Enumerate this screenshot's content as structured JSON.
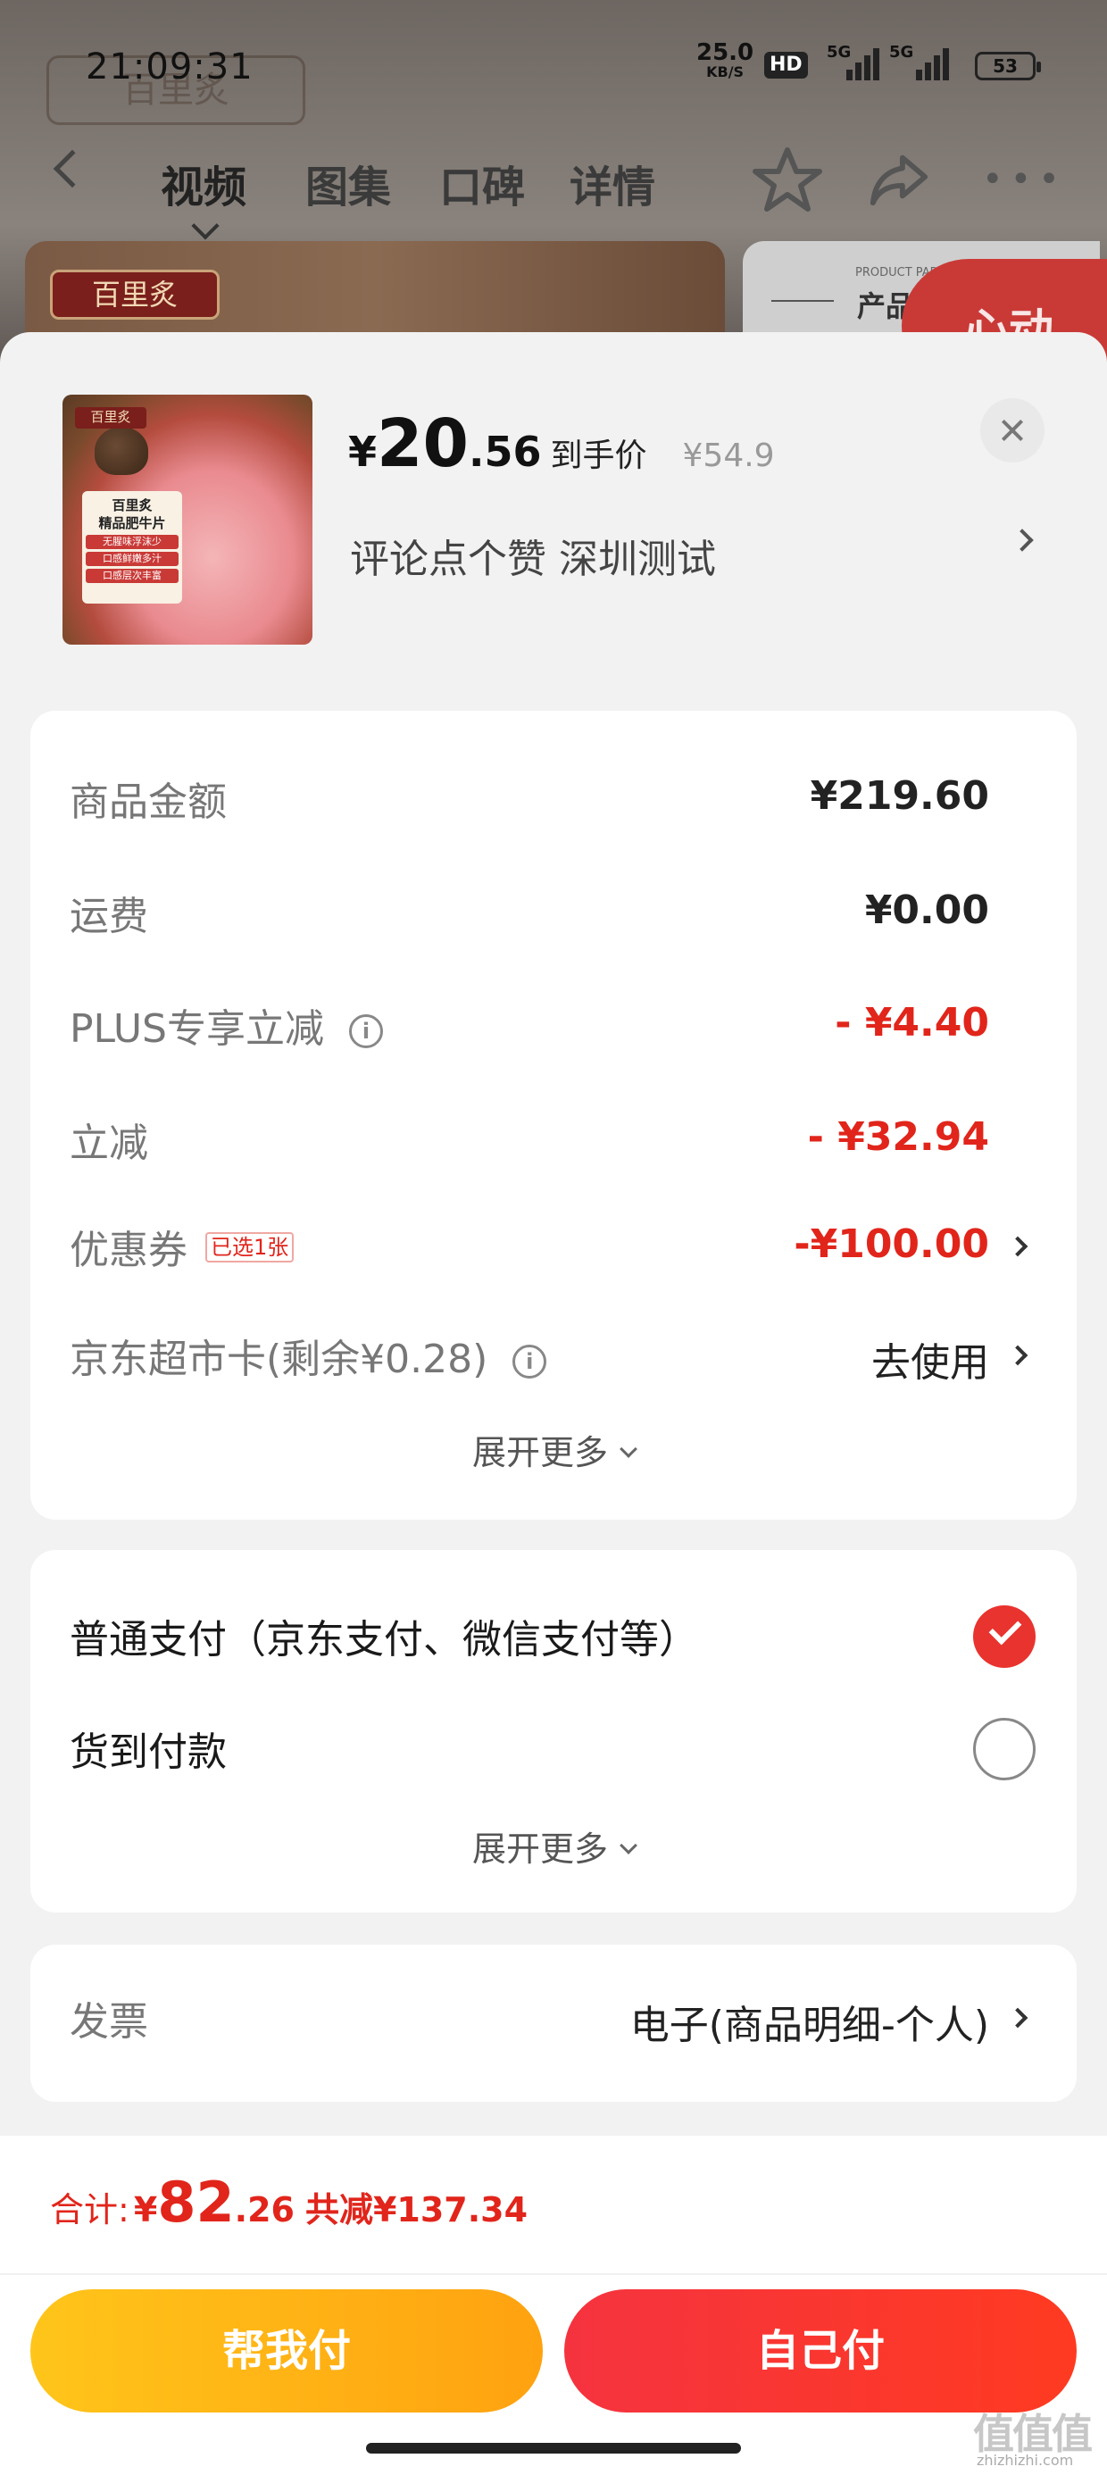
{
  "status_bar": {
    "time": "21:09:31",
    "net_speed_value": "25.0",
    "net_speed_unit": "KB/S",
    "hd": "HD",
    "signal_1": "5G",
    "signal_2": "5G",
    "battery": "53"
  },
  "background": {
    "brand_ghost": "百里炙",
    "brand_logo": "百里炙",
    "tabs": [
      "视频",
      "图集",
      "口碑",
      "详情"
    ],
    "param_small": "PRODUCT PARAMET",
    "param_title": "产品",
    "badge": "心动"
  },
  "product": {
    "image_logo": "百里炙",
    "image_pack_title": "百里炙",
    "image_pack_name": "精品肥牛片",
    "image_pack_tags": [
      "无腥味浮沫少",
      "口感鲜嫩多汁",
      "口感层次丰富"
    ],
    "price_currency": "¥",
    "price_integer": "20",
    "price_decimal": ".56",
    "price_label": "到手价",
    "original_price": "¥54.9",
    "subtitle": "评论点个赞  深圳测试"
  },
  "summary": {
    "rows": [
      {
        "label": "商品金额",
        "value": "¥219.60"
      },
      {
        "label": "运费",
        "value": "¥0.00"
      },
      {
        "label": "PLUS专享立减",
        "value": "- ¥4.40"
      },
      {
        "label": "立减",
        "value": "- ¥32.94"
      },
      {
        "label": "优惠券",
        "tag": "已选1张",
        "value": "-¥100.00"
      },
      {
        "label": "京东超市卡(剩余¥0.28)",
        "value": "去使用"
      }
    ],
    "expand_label": "展开更多"
  },
  "payment": {
    "options": [
      {
        "label": "普通支付（京东支付、微信支付等）",
        "selected": true
      },
      {
        "label": "货到付款",
        "selected": false
      }
    ],
    "expand_label": "展开更多"
  },
  "invoice": {
    "label": "发票",
    "value": "电子(商品明细-个人)"
  },
  "footer": {
    "total_label": "合计:",
    "total_currency": "¥",
    "total_integer": "82",
    "total_decimal": ".26",
    "discount_text": "共减¥137.34",
    "btn_friend": "帮我付",
    "btn_self": "自己付"
  },
  "watermark": {
    "text": "值值值",
    "domain": "zhizhizhi.com"
  },
  "colors": {
    "accent_red": "#e1251b",
    "friend_button": "#ffb514",
    "self_button": "#f5333f"
  }
}
